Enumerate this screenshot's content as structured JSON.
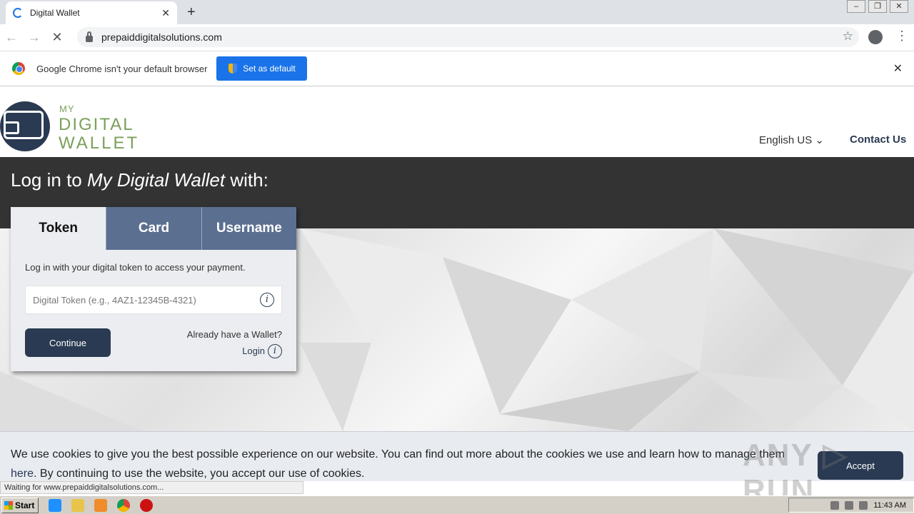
{
  "browser": {
    "tab_title": "Digital Wallet",
    "tab_close": "✕",
    "new_tab": "+",
    "url": "prepaiddigitalsolutions.com",
    "nav": {
      "back": "←",
      "forward": "→",
      "stop": "✕"
    },
    "star": "☆",
    "menu": "⋮",
    "window_controls": {
      "minimize": "–",
      "restore": "❐",
      "close": "✕"
    }
  },
  "infobar": {
    "message": "Google Chrome isn't your default browser",
    "button_label": "Set as default",
    "close": "✕"
  },
  "header": {
    "logo_line1": "MY",
    "logo_line2": "DIGITAL",
    "logo_line3": "WALLET",
    "language": "English US ⌄",
    "contact": "Contact Us"
  },
  "hero": {
    "title_prefix": "Log in to ",
    "title_brand": "My Digital Wallet",
    "title_suffix": " with:"
  },
  "login": {
    "tabs": [
      "Token",
      "Card",
      "Username"
    ],
    "active_tab": "Token",
    "description": "Log in with your digital token to access your payment.",
    "token_placeholder": "Digital Token (e.g., 4AZ1-12345B-4321)",
    "info_glyph": "i",
    "continue_label": "Continue",
    "already_text": "Already have a Wallet?",
    "login_link": "Login"
  },
  "cookie": {
    "text_before": "We use cookies to give you the best possible experience on our website. You can find out more about the cookies we use and learn how to manage them ",
    "link": "here",
    "text_after": ". By continuing to use the website, you accept our use of cookies.",
    "accept_label": "Accept"
  },
  "watermark": "ANY ▷ RUN",
  "status_bar": "Waiting for www.prepaiddigitalsolutions.com...",
  "taskbar": {
    "start_label": "Start",
    "clock": "11:43 AM"
  },
  "colors": {
    "brand_navy": "#2a3a52",
    "brand_green": "#7ba05b",
    "tab_blue": "#5b6f91",
    "chrome_blue": "#1a73e8"
  }
}
